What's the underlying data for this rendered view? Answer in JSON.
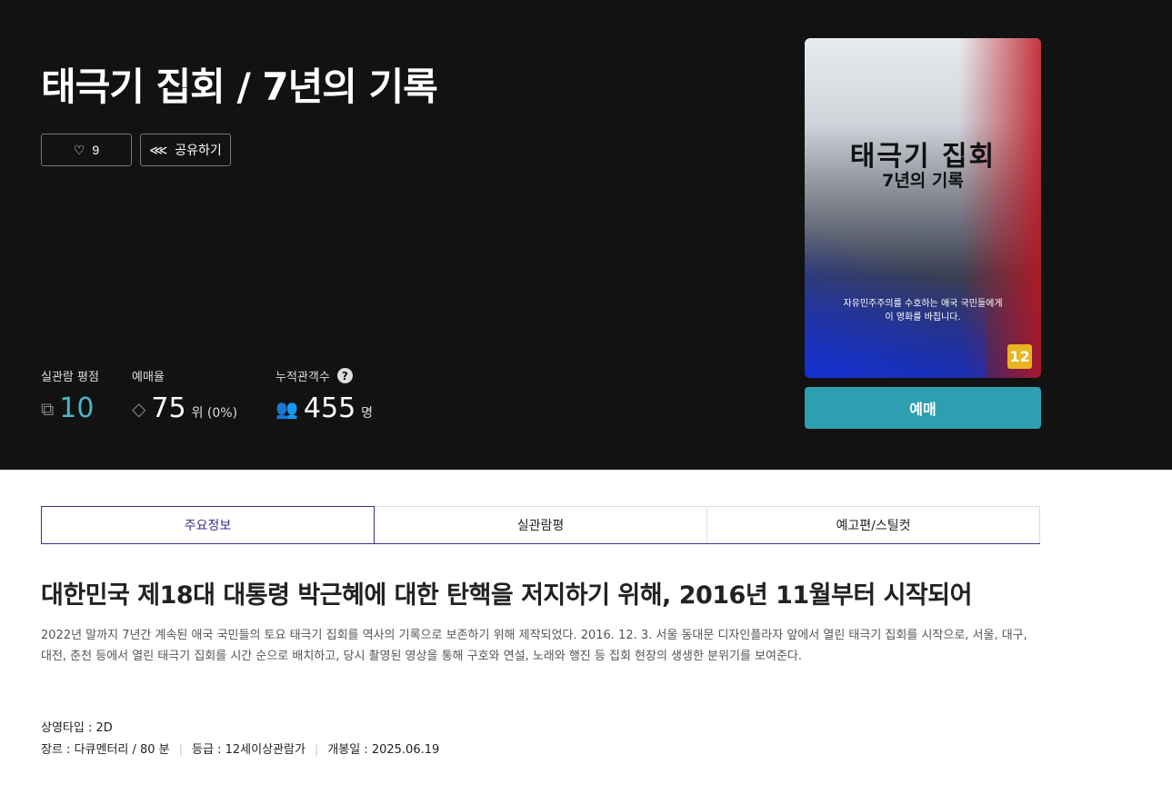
{
  "movie": {
    "title": "태극기 집회 / 7년의 기록"
  },
  "actions": {
    "like_count": "9",
    "share_label": "공유하기"
  },
  "stats": {
    "rating_label": "실관람 평점",
    "rating_value": "10",
    "booking_label": "예매율",
    "booking_rank": "75",
    "booking_unit": "위 (0%)",
    "audience_label": "누적관객수",
    "audience_value": "455",
    "audience_unit": "명"
  },
  "poster": {
    "title": "태극기 집회",
    "subtitle": "7년의 기록",
    "dedication_1": "자유민주주의를 수호하는 애국 국민들에게",
    "dedication_2": "이 영화를 바칩니다.",
    "age_rating": "12"
  },
  "book_label": "예매",
  "tabs": [
    "주요정보",
    "실관람평",
    "예고편/스틸컷"
  ],
  "headline": "대한민국 제18대 대통령 박근혜에 대한 탄핵을 저지하기 위해, 2016년 11월부터 시작되어",
  "description": "2022년 말까지 7년간 계속된 애국 국민들의 토요 태극기 집회를 역사의 기록으로 보존하기 위해 제작되었다. 2016. 12. 3. 서울 동대문 디자인플라자 앞에서 열린 태극기 집회를 시작으로, 서울, 대구, 대전, 춘천 등에서 열린 태극기 집회를 시간 순으로 배치하고, 당시 촬영된 영상을 통해 구호와 연설, 노래와 행진 등 집회 현장의 생생한 분위기를 보여준다.",
  "details": {
    "screen_type": "상영타입 : 2D",
    "genre": "장르 : 다큐멘터리 / 80 분",
    "grade": "등급 : 12세이상관람가",
    "release": "개봉일 : 2025.06.19"
  },
  "colors": {
    "accent": "#2e9fb0",
    "tab": "#3d2e87",
    "rating": "#4fb3c6"
  }
}
